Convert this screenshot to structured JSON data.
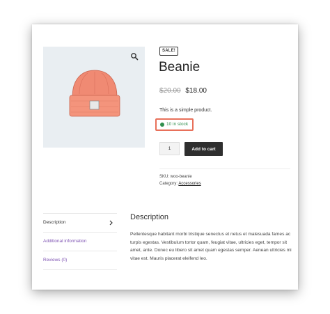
{
  "product": {
    "badge": "SALE!",
    "title": "Beanie",
    "old_price": "$20.00",
    "price": "$18.00",
    "short_description": "This is a simple product.",
    "stock": "10 in stock",
    "quantity": "1",
    "add_to_cart": "Add to cart",
    "sku_label": "SKU: woo-beanie",
    "category_label": "Category: ",
    "category_link": "Accessories"
  },
  "tabs": [
    {
      "label": "Description"
    },
    {
      "label": "Additional information"
    },
    {
      "label": "Reviews (0)"
    }
  ],
  "description": {
    "heading": "Description",
    "body": "Pellentesque habitant morbi tristique senectus et netus et malesuada fames ac turpis egestas. Vestibulum tortor quam, feugiat vitae, ultricies eget, tempor sit amet, ante. Donec eu libero sit amet quam egestas semper. Aenean ultricies mi vitae est. Mauris placerat eleifend leo."
  },
  "icons": {
    "zoom": "magnifier-icon",
    "tab_active": "chevron-right-icon"
  },
  "colors": {
    "accent_link": "#7f54b3",
    "stock_green": "#2f8f4e",
    "highlight_box": "#e8705a",
    "button_bg": "#2f2f2f",
    "beanie": "#f08a73"
  }
}
